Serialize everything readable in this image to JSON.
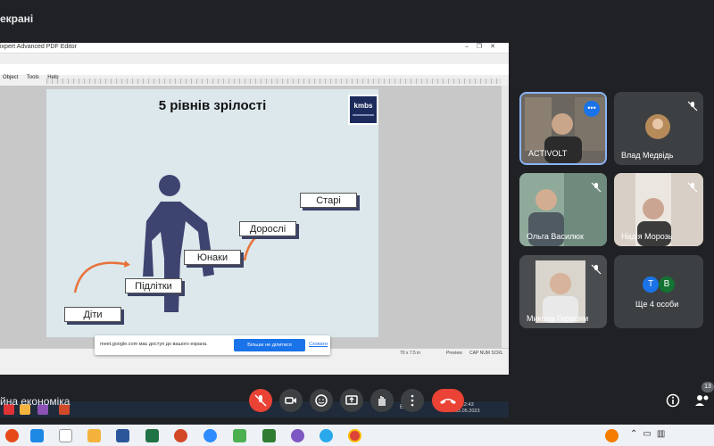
{
  "meeting": {
    "banner_text": "екрані",
    "name": "йна економіка",
    "people_badge": "13"
  },
  "shared_screen": {
    "window_title": "ixpert Advanced PDF Editor",
    "menu": [
      "Object",
      "Tools",
      "Help"
    ],
    "slide": {
      "title": "5 рівнів зрілості",
      "logo": "kmbs",
      "steps": [
        "Діти",
        "Підлітки",
        "Юнаки",
        "Дорослі",
        "Старі"
      ]
    },
    "status_bar": {
      "left": "70 x 7.5 in",
      "preview": "Preview",
      "mode": "CAP NUM SCRL"
    },
    "notification": {
      "message": "meet.google.com має доступ до вашого екрана.",
      "stop_label": "Більше не ділитися",
      "hide_label": "Сховати"
    },
    "system_tray": {
      "lang": "ENG",
      "time": "12:43",
      "date": "05.05.2023"
    }
  },
  "participants": [
    {
      "name": "ACTIVOLT",
      "initial": ""
    },
    {
      "name": "Влад Медвідь",
      "initial": ""
    },
    {
      "name": "Ольга Василюк",
      "initial": ""
    },
    {
      "name": "Надія Морозь",
      "initial": ""
    },
    {
      "name": "Микола Герасим",
      "initial": ""
    },
    {
      "name": "Ще 4 особи",
      "avatars": [
        "Т",
        "В"
      ]
    }
  ],
  "colors": {
    "end_call": "#ea4335",
    "accent": "#1a73e8",
    "tile_bg": "#3c4043"
  },
  "controls": [
    "mic-off-icon",
    "camera-icon",
    "emoji-icon",
    "present-icon",
    "raise-hand-icon",
    "more-icon",
    "end-call-icon"
  ]
}
